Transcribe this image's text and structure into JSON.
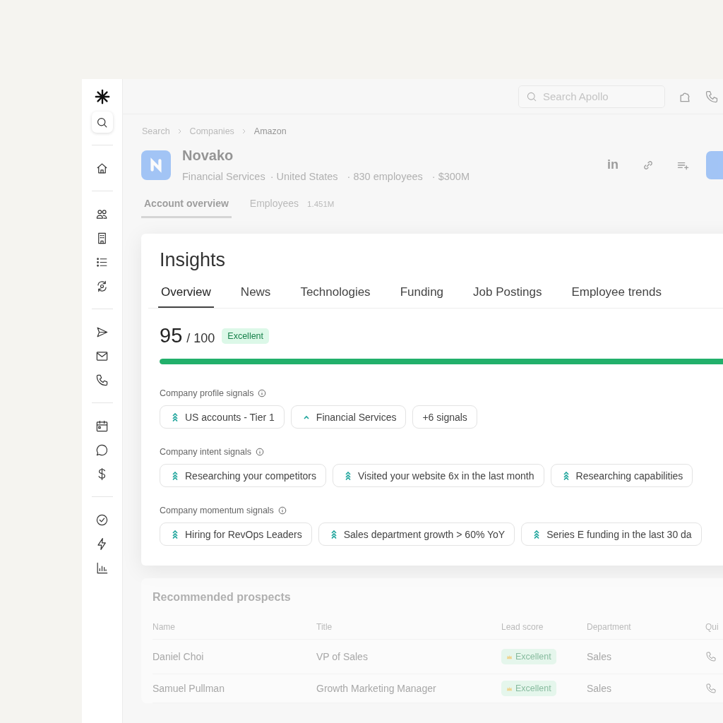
{
  "sidebar": {
    "items": [
      {
        "kind": "search",
        "selected": true
      },
      {
        "kind": "divider"
      },
      {
        "kind": "home"
      },
      {
        "kind": "divider"
      },
      {
        "kind": "people"
      },
      {
        "kind": "building"
      },
      {
        "kind": "list"
      },
      {
        "kind": "refresh"
      },
      {
        "kind": "divider"
      },
      {
        "kind": "send"
      },
      {
        "kind": "mail"
      },
      {
        "kind": "phone"
      },
      {
        "kind": "divider"
      },
      {
        "kind": "calendar"
      },
      {
        "kind": "chat"
      },
      {
        "kind": "dollar"
      },
      {
        "kind": "divider"
      },
      {
        "kind": "check"
      },
      {
        "kind": "bolt"
      },
      {
        "kind": "chart"
      }
    ]
  },
  "top_bar": {
    "search": {
      "placeholder": "Search Apollo"
    }
  },
  "breadcrumb": [
    {
      "label": "Search",
      "current": false
    },
    {
      "label": "Companies",
      "current": false
    },
    {
      "label": "Amazon",
      "current": true
    }
  ],
  "company": {
    "name": "Novako",
    "details": [
      "Financial Services",
      "· United States",
      "· 830 employees",
      "· $300M"
    ],
    "linkedin_label": "in"
  },
  "page_tabs": [
    {
      "label": "Account overview",
      "selected": true
    },
    {
      "label": "Employees",
      "count": "1.451M",
      "selected": false
    }
  ],
  "insights": {
    "title": "Insights",
    "tabs": [
      {
        "label": "Overview",
        "selected": true
      },
      {
        "label": "News",
        "selected": false
      },
      {
        "label": "Technologies",
        "selected": false
      },
      {
        "label": "Funding",
        "selected": false
      },
      {
        "label": "Job Postings",
        "selected": false
      },
      {
        "label": "Employee trends",
        "selected": false
      }
    ],
    "score": {
      "value": "95",
      "max": "/ 100",
      "rating": "Excellent",
      "level": 0.95
    },
    "sections": [
      {
        "title": "Company profile signals",
        "chips": [
          {
            "kind": "strong",
            "label": "US accounts - Tier 1"
          },
          {
            "kind": "medium",
            "label": "Financial Services"
          },
          {
            "kind": "more",
            "label": "+6 signals"
          }
        ]
      },
      {
        "title": "Company intent signals",
        "chips": [
          {
            "kind": "strong",
            "label": "Researching your competitors"
          },
          {
            "kind": "strong",
            "label": "Visited your website 6x in the last month"
          },
          {
            "kind": "strong",
            "label": "Researching capabilities"
          }
        ]
      },
      {
        "title": "Company momentum signals",
        "chips": [
          {
            "kind": "strong",
            "label": "Hiring for RevOps Leaders"
          },
          {
            "kind": "strong",
            "label": "Sales department growth > 60% YoY"
          },
          {
            "kind": "strong",
            "label": "Series E funding in the last 30 da"
          }
        ]
      }
    ]
  },
  "prospects": {
    "title": "Recommended prospects",
    "columns": [
      "Name",
      "Title",
      "Lead score",
      "Department",
      "Qui"
    ],
    "rows": [
      {
        "name": "Daniel Choi",
        "title": "VP of Sales",
        "lead_score": "Excellent",
        "department": "Sales"
      },
      {
        "name": "Samuel Pullman",
        "title": "Growth Marketing Manager",
        "lead_score": "Excellent",
        "department": "Sales"
      }
    ]
  }
}
